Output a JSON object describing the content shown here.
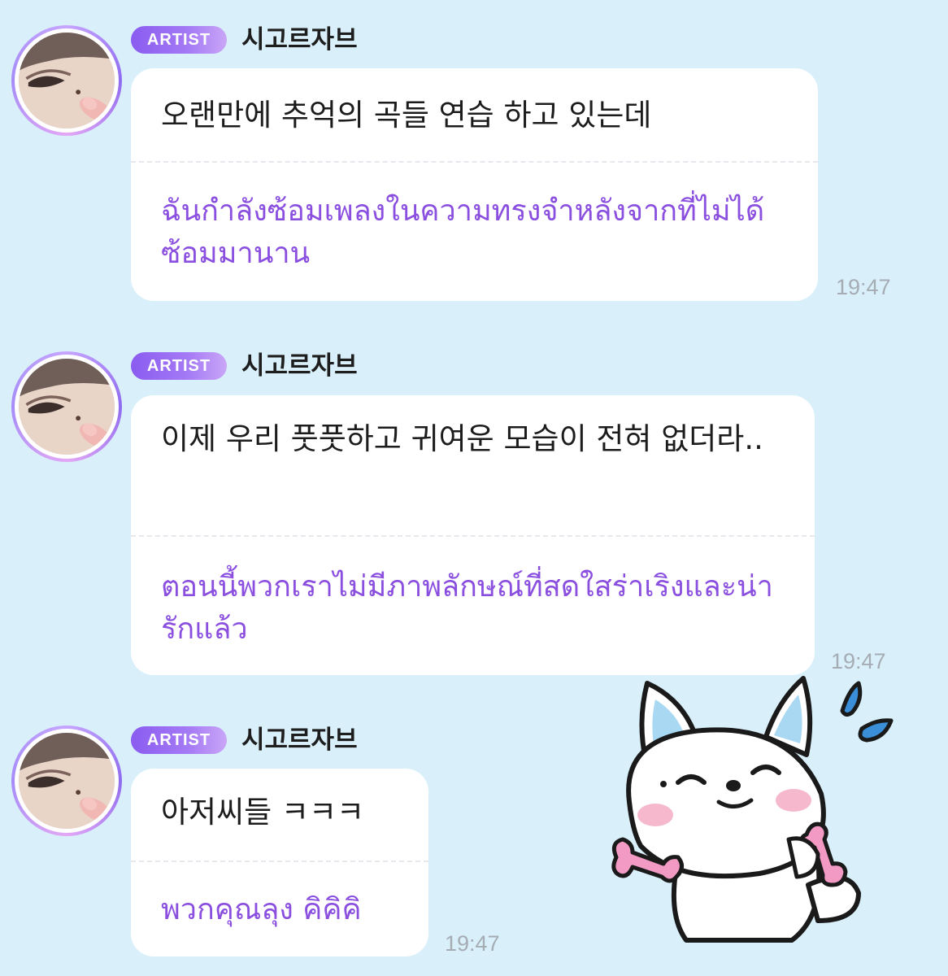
{
  "colors": {
    "background": "#d9f0fb",
    "badge": "#8a5cf0",
    "translation_text": "#8b4fe0",
    "timestamp": "#a6acb3"
  },
  "messages": [
    {
      "badge": "ARTIST",
      "sender": "시고르자브",
      "korean": "오랜만에 추억의 곡들 연습 하고 있는데",
      "thai": "ฉันกำลังซ้อมเพลงในความทรงจำหลังจากที่ไม่ได้ซ้อมมานาน",
      "time": "19:47"
    },
    {
      "badge": "ARTIST",
      "sender": "시고르자브",
      "korean": "이제 우리 풋풋하고 귀여운 모습이 전혀 없더라..",
      "thai": "ตอนนี้พวกเราไม่มีภาพลักษณ์ที่สดใสร่าเริงและน่ารักแล้ว",
      "time": "19:47"
    },
    {
      "badge": "ARTIST",
      "sender": "시고르자브",
      "korean": "아저씨들 ㅋㅋㅋ",
      "thai": "พวกคุณลุง คิคิคิ",
      "time": "19:47"
    }
  ],
  "sticker": {
    "icon": "white-fox-dumbbell-sticker-icon"
  }
}
